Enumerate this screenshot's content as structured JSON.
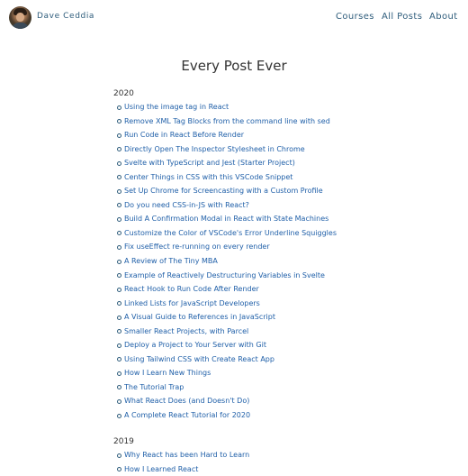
{
  "header": {
    "site_name": "Dave Ceddia",
    "nav": {
      "courses": "Courses",
      "all_posts": "All Posts",
      "about": "About"
    }
  },
  "page_title": "Every Post Ever",
  "groups": [
    {
      "year": "2020",
      "posts": [
        "Using the image tag in React",
        "Remove XML Tag Blocks from the command line with sed",
        "Run Code in React Before Render",
        "Directly Open The Inspector Stylesheet in Chrome",
        "Svelte with TypeScript and Jest (Starter Project)",
        "Center Things in CSS with this VSCode Snippet",
        "Set Up Chrome for Screencasting with a Custom Profile",
        "Do you need CSS-in-JS with React?",
        "Build A Confirmation Modal in React with State Machines",
        "Customize the Color of VSCode's Error Underline Squiggles",
        "Fix useEffect re-running on every render",
        "A Review of The Tiny MBA",
        "Example of Reactively Destructuring Variables in Svelte",
        "React Hook to Run Code After Render",
        "Linked Lists for JavaScript Developers",
        "A Visual Guide to References in JavaScript",
        "Smaller React Projects, with Parcel",
        "Deploy a Project to Your Server with Git",
        "Using Tailwind CSS with Create React App",
        "How I Learn New Things",
        "The Tutorial Trap",
        "What React Does (and Doesn't Do)",
        "A Complete React Tutorial for 2020"
      ]
    },
    {
      "year": "2019",
      "posts": [
        "Why React has been Hard to Learn",
        "How I Learned React"
      ]
    }
  ]
}
